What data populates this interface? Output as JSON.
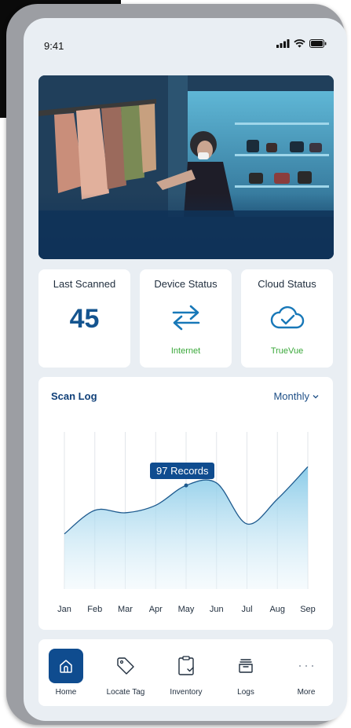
{
  "status_bar": {
    "time": "9:41"
  },
  "hero": {
    "image_alt": "Shopper browsing clothing racks in a retail store"
  },
  "cards": {
    "last_scanned": {
      "title": "Last Scanned",
      "value": "45"
    },
    "device_status": {
      "title": "Device Status",
      "subtitle": "Internet",
      "icon": "sync-arrows-icon"
    },
    "cloud_status": {
      "title": "Cloud Status",
      "subtitle": "TrueVue",
      "icon": "cloud-check-icon"
    }
  },
  "scan_log": {
    "title": "Scan Log",
    "period": "Monthly",
    "tooltip": "97 Records"
  },
  "chart_data": {
    "type": "area",
    "title": "Scan Log",
    "categories": [
      "Jan",
      "Feb",
      "Mar",
      "Apr",
      "May",
      "Jun",
      "Jul",
      "Aug",
      "Sep"
    ],
    "highlight": {
      "category": "May",
      "label": "97 Records",
      "value": 97
    },
    "values": [
      58,
      77,
      75,
      81,
      97,
      99,
      66,
      86,
      112
    ],
    "grid": "vertical",
    "colors": {
      "line": "#1e5a8e",
      "fill_top": "#7ec6e6",
      "fill_bottom": "#e9f5fb"
    }
  },
  "nav": {
    "items": [
      {
        "label": "Home",
        "icon": "home-icon",
        "active": true
      },
      {
        "label": "Locate Tag",
        "icon": "tag-icon",
        "active": false
      },
      {
        "label": "Inventory",
        "icon": "clipboard-check-icon",
        "active": false
      },
      {
        "label": "Logs",
        "icon": "archive-box-icon",
        "active": false
      },
      {
        "label": "More",
        "icon": "more-dots-icon",
        "active": false
      }
    ]
  },
  "colors": {
    "primary": "#0f4c8f",
    "accent_green": "#3aa83a",
    "screen_bg": "#e9eef3"
  }
}
